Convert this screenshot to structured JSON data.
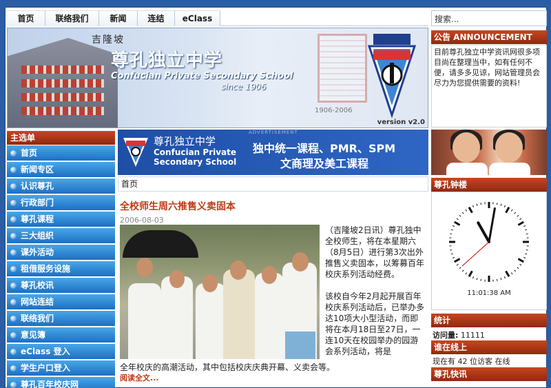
{
  "nav": {
    "items": [
      "首页",
      "联络我们",
      "新闻",
      "连结",
      "eClass"
    ]
  },
  "search": {
    "placeholder": "搜索..."
  },
  "banner": {
    "location": "吉隆坡",
    "school_cn": "尊孔独立中学",
    "school_en": "Confucian Private Secondary School",
    "since": "since 1906",
    "years": "1906-2006",
    "version": "version v2.0"
  },
  "announcement": {
    "title": "公告 ANNOUNCEMENT",
    "body": "目前尊孔独立中学资讯网很多项目尚在整理当中，如有任何不便，请多多见谅，网站管理员会尽力为您提供需要的资料!"
  },
  "menu": {
    "title": "主选单",
    "items": [
      "首页",
      "新闻专区",
      "认识尊孔",
      "行政部门",
      "尊孔课程",
      "三大组织",
      "课外活动",
      "租借服务设施",
      "尊孔校讯",
      "网站连结",
      "联络我们",
      "意见簿",
      "eClass 登入",
      "学生户口登入",
      "尊孔百年校庆网"
    ]
  },
  "ad": {
    "label": "ADVERTISEMENT",
    "cn": "尊孔独立中学",
    "en": "Confucian Private Secondary School",
    "line1": "独中统一课程、PMR、SPM",
    "line2": "文商理及美工课程"
  },
  "breadcrumb": "首页",
  "article": {
    "title": "全校师生周六推售义卖固本",
    "date": "2006-08-03",
    "para1": "（吉隆坡2日讯）尊孔独中全校师生，将在本星期六（8月5日）进行第3次出外推售义卖固本，以筹募百年校庆系列活动经费。",
    "para2": "该校自今年2月起开展百年校庆系列活动后，已举办多达10项大小型活动，而即将在本月18日至27日，一连10天在校园举办的园游会系列活动，将是",
    "para3": "全年校庆的高潮活动，其中包括校庆庆典开幕、义卖会等。",
    "read_more": "阅读全文..."
  },
  "clock": {
    "title": "尊孔钟楼",
    "time": "11:01:38 AM",
    "hour": 11,
    "minute": 1,
    "second": 38
  },
  "stats": {
    "title": "统计",
    "visits_label": "访问量:",
    "visits": "11111"
  },
  "online": {
    "title": "谁在线上",
    "text": "现在有 42 位访客 在线"
  },
  "quicklinks": {
    "title": "尊孔快讯"
  },
  "colors": {
    "accent": "#c8451f",
    "menu_blue": "#1d6fc4",
    "page_bg": "#2a5da3",
    "title_red": "#c03a17"
  }
}
